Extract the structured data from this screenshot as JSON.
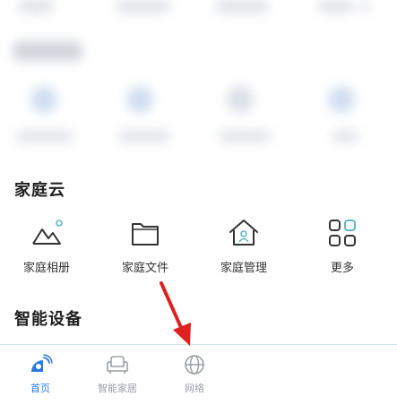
{
  "family_cloud": {
    "title": "家庭云",
    "items": [
      {
        "label": "家庭相册",
        "icon": "photo-album-icon"
      },
      {
        "label": "家庭文件",
        "icon": "folder-icon"
      },
      {
        "label": "家庭管理",
        "icon": "home-manage-icon"
      },
      {
        "label": "更多",
        "icon": "more-grid-icon"
      }
    ]
  },
  "smart_devices": {
    "title": "智能设备"
  },
  "bottom_nav": {
    "items": [
      {
        "label": "首页",
        "icon": "home-satellite-icon",
        "active": true
      },
      {
        "label": "智能家居",
        "icon": "sofa-icon",
        "active": false
      },
      {
        "label": "网络",
        "icon": "globe-icon",
        "active": false
      }
    ]
  },
  "colors": {
    "accent": "#2b78e4",
    "annotation_arrow": "#e02020",
    "nav_inactive": "#9aa0a6"
  }
}
